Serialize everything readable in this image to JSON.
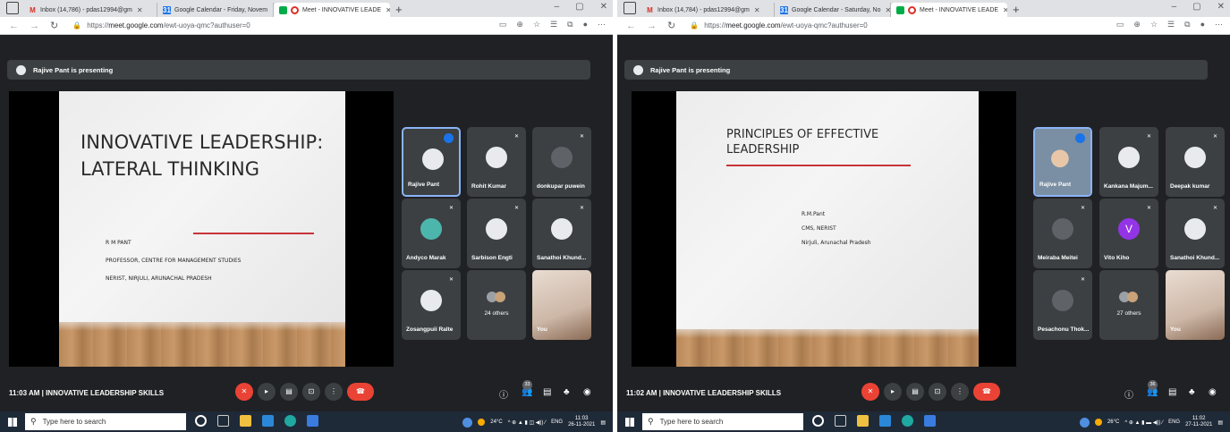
{
  "left": {
    "tabs": [
      {
        "label": "Inbox (14,786) - pdas12994@gm",
        "favicon": "gmail-icon"
      },
      {
        "label": "Google Calendar - Friday, Novem",
        "favicon": "calendar-icon"
      },
      {
        "label": "Meet - INNOVATIVE LEADE",
        "favicon": "meet-icon"
      }
    ],
    "url_prefix": "https://",
    "url_host": "meet.google.com",
    "url_path": "/ewt-uoya-qmc?authuser=0",
    "banner": "Rajive Pant is presenting",
    "slide": {
      "title_line1": "INNOVATIVE LEADERSHIP:",
      "title_line2": "LATERAL THINKING",
      "line1": "R M PANT",
      "line2": "PROFESSOR, CENTRE FOR MANAGEMENT STUDIES",
      "line3": "NERIST, NIRJULI, ARUNACHAL PRADESH"
    },
    "tiles": [
      {
        "name": "Rajive Pant"
      },
      {
        "name": "Rohit Kumar"
      },
      {
        "name": "donkupar puwein"
      },
      {
        "name": "Andyco Marak"
      },
      {
        "name": "Sarbison Engti"
      },
      {
        "name": "Sanathoi Khund..."
      },
      {
        "name": "Zosangpuii Ralte"
      },
      {
        "name": "24 others"
      },
      {
        "name": "You"
      }
    ],
    "meeting": "11:03 AM  |  INNOVATIVE LEADERSHIP SKILLS",
    "participants": "33",
    "search_placeholder": "Type here to search",
    "weather": "24°C",
    "lang": "ENG",
    "clock_time": "11:03",
    "clock_date": "26-11-2021"
  },
  "right": {
    "tabs": [
      {
        "label": "Inbox (14,784) - pdas12994@gm",
        "favicon": "gmail-icon"
      },
      {
        "label": "Google Calendar - Saturday, No",
        "favicon": "calendar-icon"
      },
      {
        "label": "Meet - INNOVATIVE LEADE",
        "favicon": "meet-icon"
      }
    ],
    "url_prefix": "https://",
    "url_host": "meet.google.com",
    "url_path": "/ewt-uoya-qmc?authuser=0",
    "banner": "Rajive Pant is presenting",
    "slide": {
      "title_line1": "PRINCIPLES OF EFFECTIVE",
      "title_line2": "LEADERSHIP",
      "line1": "R.M.Pant",
      "line2": "CMS, NERIST",
      "line3": "Nirjuli, Arunachal Pradesh"
    },
    "tiles": [
      {
        "name": "Rajive Pant"
      },
      {
        "name": "Kankana Majum..."
      },
      {
        "name": "Deepak kumar"
      },
      {
        "name": "Meiraba Meitei"
      },
      {
        "name": "Vito Kiho"
      },
      {
        "name": "Sanathoi Khund..."
      },
      {
        "name": "Pesachonu Thok..."
      },
      {
        "name": "27 others"
      },
      {
        "name": "You"
      }
    ],
    "vito_initial": "V",
    "meeting": "11:02 AM  |  INNOVATIVE LEADERSHIP SKILLS",
    "participants": "36",
    "search_placeholder": "Type here to search",
    "weather": "26°C",
    "lang": "ENG",
    "clock_time": "11:02",
    "clock_date": "27-11-2021"
  },
  "colors": {
    "meet_bg": "#202124",
    "tile_bg": "#3c4043",
    "end_call": "#ea4335",
    "accent": "#8ab4f8",
    "slide_underline": "#c8333a"
  }
}
